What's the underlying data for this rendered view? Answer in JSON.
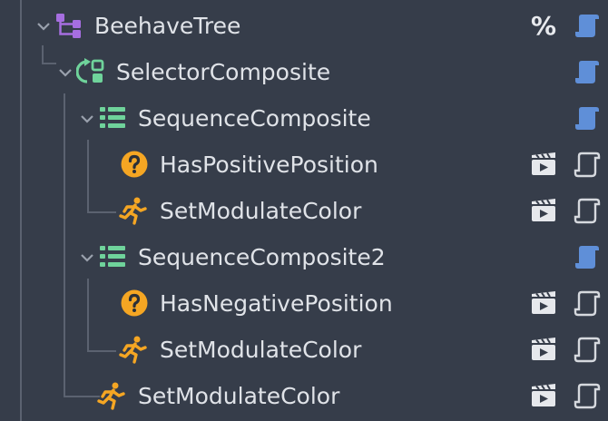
{
  "tree": {
    "root": {
      "label": "BeehaveTree",
      "indicator": "%"
    },
    "nodes": [
      {
        "label": "SelectorComposite",
        "icon": "selector-icon"
      },
      {
        "label": "SequenceComposite",
        "icon": "sequence-icon"
      },
      {
        "label": "HasPositivePosition",
        "icon": "condition-icon"
      },
      {
        "label": "SetModulateColor",
        "icon": "action-icon"
      },
      {
        "label": "SequenceComposite2",
        "icon": "sequence-icon"
      },
      {
        "label": "HasNegativePosition",
        "icon": "condition-icon"
      },
      {
        "label": "SetModulateColor",
        "icon": "action-icon"
      },
      {
        "label": "SetModulateColor",
        "icon": "action-icon"
      }
    ]
  },
  "colors": {
    "background": "#363d4a",
    "tree_purple": "#a66ee0",
    "composite_green": "#6fd39b",
    "condition_orange": "#f5a623",
    "script_blue": "#5f8fd8",
    "script_white": "#d6d9de"
  }
}
